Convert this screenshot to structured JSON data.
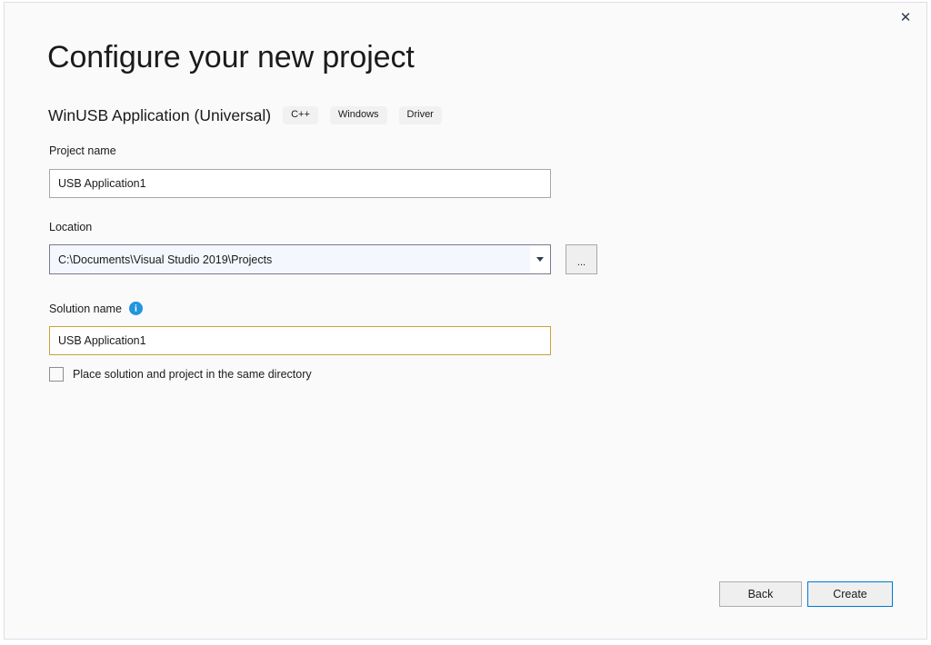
{
  "window": {
    "close_label": "✕"
  },
  "header": {
    "title": "Configure your new project",
    "subtitle": "WinUSB Application (Universal)",
    "tags": [
      "C++",
      "Windows",
      "Driver"
    ]
  },
  "form": {
    "project_name": {
      "label": "Project name",
      "value": "USB Application1"
    },
    "location": {
      "label": "Location",
      "value": "C:\\Documents\\Visual Studio 2019\\Projects",
      "browse_label": "..."
    },
    "solution_name": {
      "label": "Solution name",
      "value": "USB Application1",
      "info_tooltip": "i"
    },
    "same_directory_checkbox": {
      "label": "Place solution and project in the same directory",
      "checked": false
    }
  },
  "footer": {
    "back_label": "Back",
    "create_label": "Create"
  },
  "colors": {
    "accent": "#0078d7",
    "focus_border": "#c6a23b",
    "info_blue": "#2196dd",
    "background": "#fafafa"
  }
}
